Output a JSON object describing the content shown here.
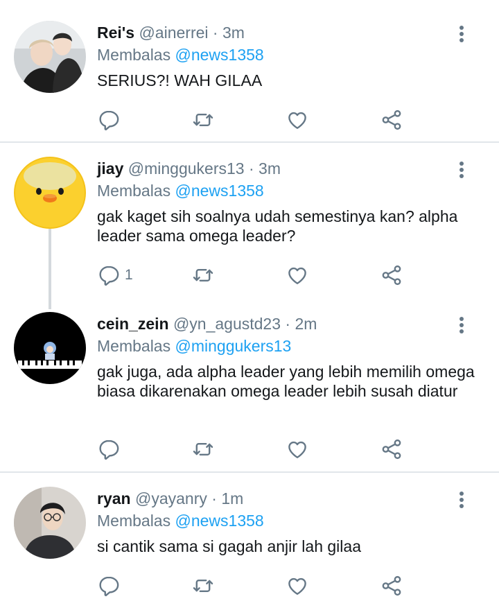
{
  "tweets": [
    {
      "name": "Rei's",
      "handle": "@ainerrei",
      "time": "· 3m",
      "reply_prefix": "Membalas",
      "reply_to": "@news1358",
      "text": "SERIUS?! WAH GILAA",
      "avatar": "avatar-two-people",
      "reply_count": ""
    },
    {
      "name": "jiay",
      "handle": "@minggukers13",
      "time": "· 3m",
      "reply_prefix": "Membalas",
      "reply_to": "@news1358",
      "text": "gak kaget sih soalnya udah semestinya kan? alpha leader sama omega leader?",
      "avatar": "avatar-yellow-chick",
      "reply_count": "1"
    },
    {
      "name": "cein_zein",
      "handle": "@yn_agustd23",
      "time": "· 2m",
      "reply_prefix": "Membalas",
      "reply_to": "@minggukers13",
      "text": "gak juga, ada alpha leader yang lebih memilih omega biasa dikarenakan omega leader lebih susah diatur",
      "avatar": "avatar-piano-character",
      "reply_count": ""
    },
    {
      "name": "ryan",
      "handle": "@yayanry",
      "time": "· 1m",
      "reply_prefix": "Membalas",
      "reply_to": "@news1358",
      "text": "si cantik sama si gagah anjir lah gilaa",
      "avatar": "avatar-man-glasses",
      "reply_count": ""
    }
  ],
  "colors": {
    "accent": "#1da1f2",
    "secondary_text": "#657786",
    "primary_text": "#14171a",
    "divider": "#e1e6ea"
  },
  "icons": [
    "reply-icon",
    "retweet-icon",
    "like-icon",
    "share-icon",
    "more-options-icon"
  ]
}
